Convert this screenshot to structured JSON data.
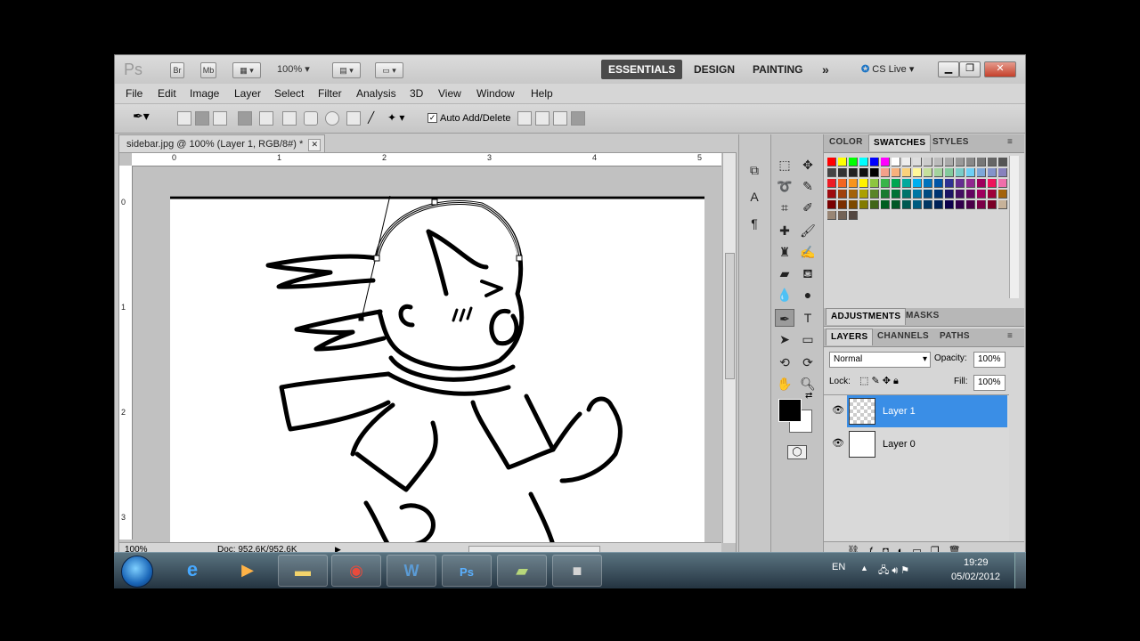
{
  "appbar": {
    "logo": "Ps",
    "bridge": "Br",
    "minibridge": "Mb",
    "zoom": "100%",
    "workspaces": [
      "ESSENTIALS",
      "DESIGN",
      "PAINTING"
    ],
    "more": "»",
    "cslive": "CS Live"
  },
  "menu": [
    "File",
    "Edit",
    "Image",
    "Layer",
    "Select",
    "Filter",
    "Analysis",
    "3D",
    "View",
    "Window",
    "Help"
  ],
  "options": {
    "auto_add_delete": "Auto Add/Delete"
  },
  "document": {
    "tab_title": "sidebar.jpg @ 100% (Layer 1, RGB/8#) *",
    "h_ruler": [
      "0",
      "1",
      "2",
      "3",
      "4",
      "5"
    ],
    "v_ruler": [
      "0",
      "1",
      "2",
      "3"
    ],
    "zoom": "100%",
    "doc_info": "Doc: 952,6K/952,6K"
  },
  "panels": {
    "color_tabs": [
      "COLOR",
      "SWATCHES",
      "STYLES"
    ],
    "adjust_tabs": [
      "ADJUSTMENTS",
      "MASKS"
    ],
    "layer_tabs": [
      "LAYERS",
      "CHANNELS",
      "PATHS"
    ],
    "blend_mode": "Normal",
    "opacity_label": "Opacity:",
    "opacity": "100%",
    "lock_label": "Lock:",
    "fill_label": "Fill:",
    "fill": "100%",
    "layers": [
      "Layer 1",
      "Layer 0"
    ]
  },
  "swatches": {
    "row1": [
      "#ff0000",
      "#ffff00",
      "#00ff00",
      "#00ffff",
      "#0000ff",
      "#ff00ff",
      "#ffffff",
      "#eeeeee",
      "#dddddd",
      "#cccccc",
      "#bbbbbb",
      "#aaaaaa",
      "#999999",
      "#888888",
      "#777777",
      "#666666",
      "#555555"
    ],
    "row2": [
      "#444444",
      "#333333",
      "#222222",
      "#111111",
      "#000000",
      "#f4a08a",
      "#f7b17c",
      "#fbd27b",
      "#fff799",
      "#c4df9b",
      "#a3d39c",
      "#82ca9c",
      "#7accc8",
      "#6dcff6",
      "#7da7d9",
      "#8393ca",
      "#8781bd"
    ],
    "row3": [
      "#ed1c24",
      "#f26522",
      "#f7941d",
      "#fff200",
      "#8dc63f",
      "#39b54a",
      "#00a651",
      "#00a99d",
      "#00aeef",
      "#0072bc",
      "#0054a6",
      "#2e3192",
      "#662d91",
      "#92278f",
      "#9e005d",
      "#ed145b",
      "#f06eaa"
    ],
    "row4": [
      "#9e0b0f",
      "#a0410d",
      "#a36209",
      "#aba000",
      "#598527",
      "#1a7b30",
      "#007236",
      "#00746b",
      "#0076a3",
      "#004b80",
      "#003471",
      "#1b1464",
      "#440e62",
      "#630460",
      "#9e005d",
      "#9e0039",
      "#a3620a"
    ],
    "row5": [
      "#790000",
      "#7b2e00",
      "#7d4900",
      "#827b00",
      "#406618",
      "#005e20",
      "#005826",
      "#005952",
      "#005b7f",
      "#003663",
      "#002157",
      "#0d004c",
      "#32004b",
      "#4b0049",
      "#7b0046",
      "#7a0026",
      "#c7b299"
    ],
    "row6": [
      "#998675",
      "#736357",
      "#534741"
    ]
  },
  "taskbar": {
    "lang": "EN",
    "time": "19:29",
    "date": "05/02/2012"
  }
}
